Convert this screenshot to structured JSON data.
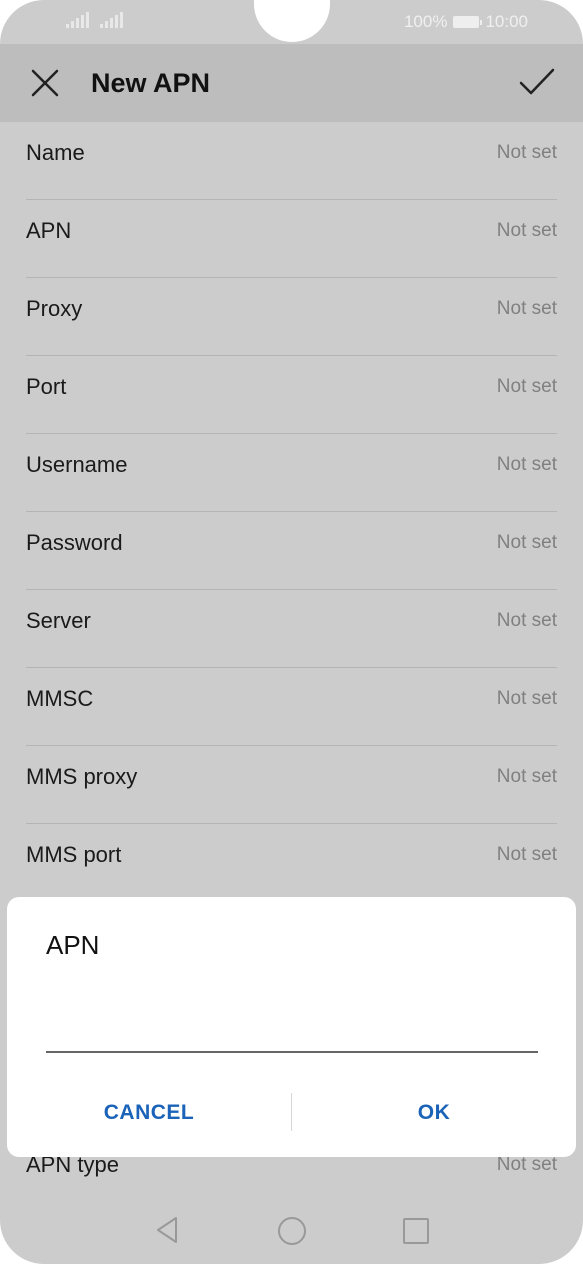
{
  "status": {
    "battery": "100%",
    "time": "10:00"
  },
  "header": {
    "title": "New APN"
  },
  "fields": [
    {
      "label": "Name",
      "value": "Not set"
    },
    {
      "label": "APN",
      "value": "Not set"
    },
    {
      "label": "Proxy",
      "value": "Not set"
    },
    {
      "label": "Port",
      "value": "Not set"
    },
    {
      "label": "Username",
      "value": "Not set"
    },
    {
      "label": "Password",
      "value": "Not set"
    },
    {
      "label": "Server",
      "value": "Not set"
    },
    {
      "label": "MMSC",
      "value": "Not set"
    },
    {
      "label": "MMS proxy",
      "value": "Not set"
    },
    {
      "label": "MMS port",
      "value": "Not set"
    }
  ],
  "under_dialog": {
    "label": "APN type",
    "value": "Not set"
  },
  "dialog": {
    "title": "APN",
    "input_value": "",
    "cancel_label": "CANCEL",
    "ok_label": "OK"
  },
  "colors": {
    "accent": "#1a63b8",
    "background": "#cccccc",
    "appbar": "#bdbdbd"
  },
  "icons": {
    "close": "close-icon",
    "confirm": "check-icon",
    "back": "back-icon",
    "home": "home-icon",
    "recents": "recents-icon"
  }
}
